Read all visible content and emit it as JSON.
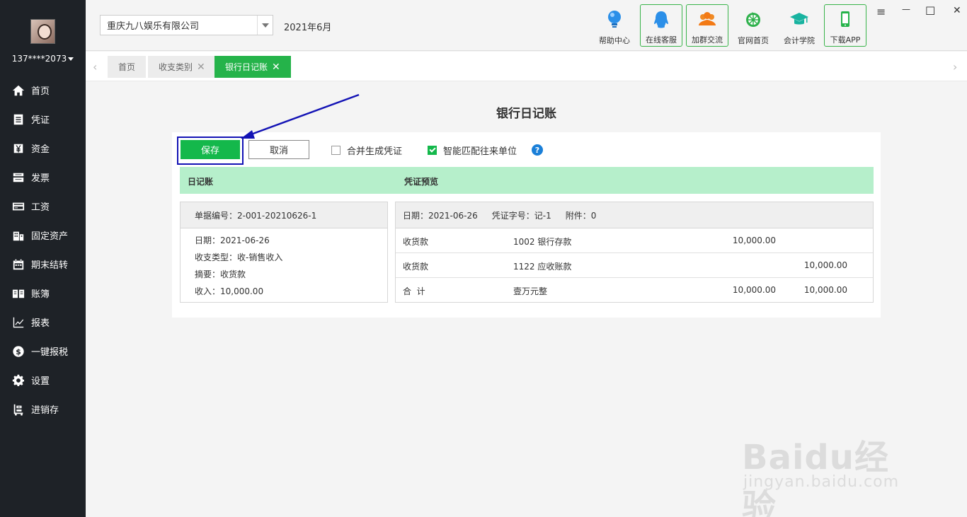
{
  "user": {
    "phone": "137****2073"
  },
  "sidebar": {
    "items": [
      {
        "label": "首页",
        "icon": "home-icon"
      },
      {
        "label": "凭证",
        "icon": "document-icon"
      },
      {
        "label": "资金",
        "icon": "yen-icon"
      },
      {
        "label": "发票",
        "icon": "invoice-icon"
      },
      {
        "label": "工资",
        "icon": "card-icon"
      },
      {
        "label": "固定资产",
        "icon": "building-icon"
      },
      {
        "label": "期末结转",
        "icon": "calendar-icon"
      },
      {
        "label": "账簿",
        "icon": "book-icon"
      },
      {
        "label": "报表",
        "icon": "chart-icon"
      },
      {
        "label": "一键报税",
        "icon": "dollar-icon"
      },
      {
        "label": "设置",
        "icon": "gear-icon"
      },
      {
        "label": "进销存",
        "icon": "inventory-icon"
      }
    ]
  },
  "header": {
    "company": "重庆九八娱乐有限公司",
    "period": "2021年6月",
    "tools": {
      "help": "帮助中心",
      "service": "在线客服",
      "group": "加群交流",
      "website": "官网首页",
      "academy": "会计学院",
      "app": "下载APP"
    },
    "window": {
      "menu": "≡",
      "minimize": "—",
      "maximize": "☐",
      "close": "✕"
    }
  },
  "tabs": [
    {
      "label": "首页",
      "closable": false
    },
    {
      "label": "收支类别",
      "closable": true
    },
    {
      "label": "银行日记账",
      "closable": true,
      "active": true
    }
  ],
  "page": {
    "title": "银行日记账",
    "save": "保存",
    "cancel": "取消",
    "merge_voucher": {
      "label": "合并生成凭证",
      "checked": false
    },
    "smart_match": {
      "label": "智能匹配往来单位",
      "checked": true
    },
    "help": "?",
    "journal_header": "日记账",
    "preview_header": "凭证预览",
    "journal": {
      "doc_no": "单据编号：2-001-20210626-1",
      "date": "日期：2021-06-26",
      "type": "收支类型：收-销售收入",
      "summary": "摘要：收货款",
      "income": "收入：10,000.00"
    },
    "voucher": {
      "date": "日期：2021-06-26",
      "voucher_no": "凭证字号：记-1",
      "attachments": "附件：0",
      "rows": [
        {
          "summary": "收货款",
          "account": "1002 银行存款",
          "debit": "10,000.00",
          "credit": ""
        },
        {
          "summary": "收货款",
          "account": "1122 应收账款",
          "debit": "",
          "credit": "10,000.00"
        },
        {
          "summary": "合  计",
          "account": "壹万元整",
          "debit": "10,000.00",
          "credit": "10,000.00"
        }
      ]
    }
  },
  "watermark": {
    "main": "Baidu经验",
    "sub": "jingyan.baidu.com"
  },
  "colors": {
    "accent": "#14b84b",
    "sidebar": "#1e2227",
    "highlight": "#1313b5"
  }
}
